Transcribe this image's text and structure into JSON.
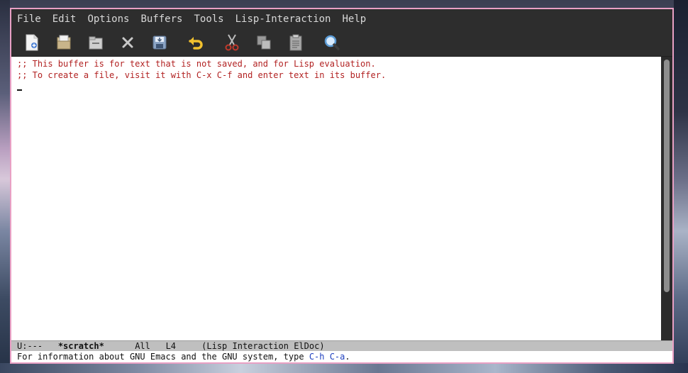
{
  "menubar": {
    "items": [
      "File",
      "Edit",
      "Options",
      "Buffers",
      "Tools",
      "Lisp-Interaction",
      "Help"
    ]
  },
  "toolbar": {
    "icons": [
      "new-file-icon",
      "open-file-icon",
      "open-directory-icon",
      "close-buffer-icon",
      "save-icon",
      "undo-icon",
      "cut-icon",
      "copy-icon",
      "paste-icon",
      "search-icon"
    ],
    "colors": {
      "undo": "#f2c12e",
      "cut": "#c0392b",
      "search": "#5b9bd5"
    }
  },
  "buffer": {
    "lines": [
      ";; This buffer is for text that is not saved, and for Lisp evaluation.",
      ";; To create a file, visit it with C-x C-f and enter text in its buffer."
    ],
    "comment_color": "#b22222"
  },
  "modeline": {
    "status": "U:---",
    "buffer_name": "*scratch*",
    "position": "All",
    "line": "L4",
    "modes": "(Lisp Interaction ElDoc)"
  },
  "minibuffer": {
    "prefix": "For information about GNU Emacs and the GNU system, type ",
    "keys": "C-h C-a",
    "suffix": "."
  }
}
